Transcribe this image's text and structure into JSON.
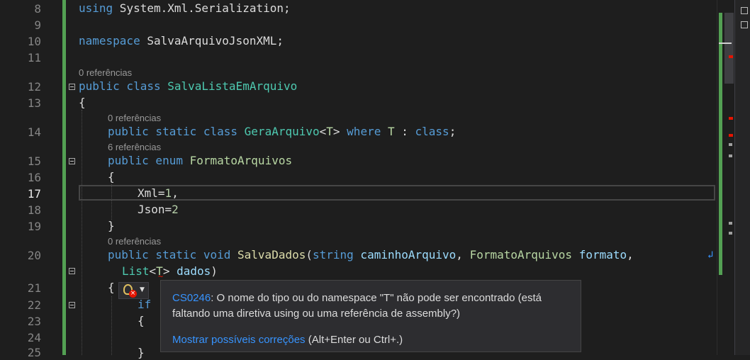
{
  "line_numbers": [
    "8",
    "9",
    "10",
    "11",
    "12",
    "13",
    "14",
    "15",
    "16",
    "17",
    "18",
    "19",
    "20",
    "21",
    "22",
    "23",
    "24",
    "25"
  ],
  "current_line": "17",
  "lens": {
    "refs0": "0 referências",
    "refs6": "6 referências"
  },
  "code": {
    "l8_kw": "using",
    "l8_rest": " System.Xml.Serialization;",
    "l10_kw": "namespace",
    "l10_rest": " SalvaArquivoJsonXML;",
    "l12_kw": "public class",
    "l12_name": " SalvaListaEmArquivo",
    "l13": "{",
    "l14_kw": "public static class",
    "l14_name": " GeraArquivo",
    "l14_lt": "<",
    "l14_t": "T",
    "l14_gt": "> ",
    "l14_where": "where",
    "l14_t2": " T",
    "l14_colon": " : ",
    "l14_class": "class",
    "l14_semi": ";",
    "l15_kw": "public enum",
    "l15_name": " FormatoArquivos",
    "l16": "{",
    "l17_name": "Xml",
    "l17_eq": "=",
    "l17_val": "1",
    "l17_end": ",",
    "l18_name": "Json",
    "l18_eq": "=",
    "l18_val": "2",
    "l19": "}",
    "l20_kw": "public static void",
    "l20_fn": " SalvaDados",
    "l20_open": "(",
    "l20_string": "string",
    "l20_p1": " caminhoArquivo",
    "l20_comma": ", ",
    "l20_type": "FormatoArquivos",
    "l20_p2": " formato",
    "l20_comma2": ",",
    "l20b_list": "List",
    "l20b_lt": "<",
    "l20b_t": "T",
    "l20b_gt": ">",
    "l20b_p": " dados",
    "l20b_close": ")",
    "l21": "{",
    "l22": "if",
    "l23": "{",
    "l25": "}"
  },
  "tooltip": {
    "error_code": "CS0246",
    "message": ": O nome do tipo ou do namespace \"T\" não pode ser encontrado (está faltando uma diretiva using ou uma referência de assembly?)",
    "fix_link": "Mostrar possíveis correções",
    "fix_shortcut": " (Alt+Enter ou Ctrl+.)"
  },
  "colors": {
    "keyword": "#569cd6",
    "type": "#4ec9b0",
    "enum": "#b8d7a3",
    "parameter": "#9cdcfe",
    "number": "#b5cea8",
    "method": "#dcdcaa",
    "error": "#e51400",
    "link": "#3794ff"
  }
}
